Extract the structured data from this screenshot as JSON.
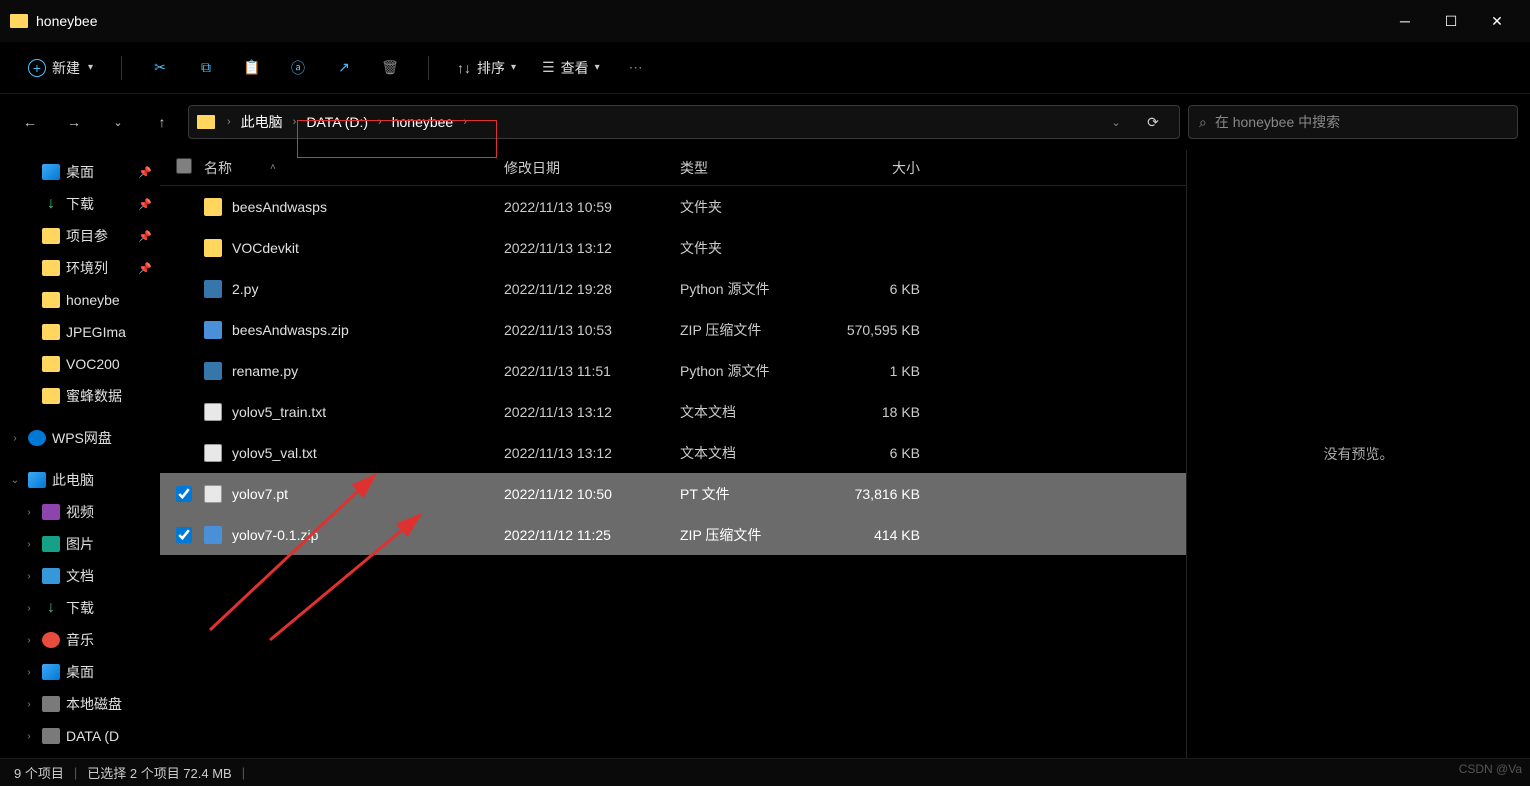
{
  "window": {
    "title": "honeybee"
  },
  "toolbar": {
    "new_label": "新建",
    "sort_label": "排序",
    "view_label": "查看"
  },
  "breadcrumb": {
    "items": [
      "此电脑",
      "DATA (D:)",
      "honeybee"
    ]
  },
  "search": {
    "placeholder": "在 honeybee 中搜索"
  },
  "sidebar": {
    "quick": [
      {
        "label": "桌面",
        "pinned": true,
        "icon": "ico-desktop"
      },
      {
        "label": "下载",
        "pinned": true,
        "icon": "ico-download"
      },
      {
        "label": "项目参",
        "pinned": true,
        "icon": "ico-folder"
      },
      {
        "label": "环境列",
        "pinned": true,
        "icon": "ico-folder"
      },
      {
        "label": "honeybe",
        "pinned": false,
        "icon": "ico-folder"
      },
      {
        "label": "JPEGIma",
        "pinned": false,
        "icon": "ico-folder"
      },
      {
        "label": "VOC200",
        "pinned": false,
        "icon": "ico-folder"
      },
      {
        "label": "蜜蜂数据",
        "pinned": false,
        "icon": "ico-folder"
      }
    ],
    "wps_label": "WPS网盘",
    "this_pc_label": "此电脑",
    "pc_items": [
      {
        "label": "视频",
        "icon": "ico-video"
      },
      {
        "label": "图片",
        "icon": "ico-pic"
      },
      {
        "label": "文档",
        "icon": "ico-doc"
      },
      {
        "label": "下载",
        "icon": "ico-download"
      },
      {
        "label": "音乐",
        "icon": "ico-music"
      },
      {
        "label": "桌面",
        "icon": "ico-desktop"
      },
      {
        "label": "本地磁盘",
        "icon": "ico-disk"
      },
      {
        "label": "DATA (D",
        "icon": "ico-disk"
      }
    ]
  },
  "columns": {
    "name": "名称",
    "date": "修改日期",
    "type": "类型",
    "size": "大小"
  },
  "files": [
    {
      "name": "beesAndwasps",
      "date": "2022/11/13 10:59",
      "type": "文件夹",
      "size": "",
      "icon": "fico-folder",
      "selected": false
    },
    {
      "name": "VOCdevkit",
      "date": "2022/11/13 13:12",
      "type": "文件夹",
      "size": "",
      "icon": "fico-folder",
      "selected": false
    },
    {
      "name": "2.py",
      "date": "2022/11/12 19:28",
      "type": "Python 源文件",
      "size": "6 KB",
      "icon": "fico-py",
      "selected": false
    },
    {
      "name": "beesAndwasps.zip",
      "date": "2022/11/13 10:53",
      "type": "ZIP 压缩文件",
      "size": "570,595 KB",
      "icon": "fico-zip",
      "selected": false
    },
    {
      "name": "rename.py",
      "date": "2022/11/13 11:51",
      "type": "Python 源文件",
      "size": "1 KB",
      "icon": "fico-py",
      "selected": false
    },
    {
      "name": "yolov5_train.txt",
      "date": "2022/11/13 13:12",
      "type": "文本文档",
      "size": "18 KB",
      "icon": "fico-txt",
      "selected": false
    },
    {
      "name": "yolov5_val.txt",
      "date": "2022/11/13 13:12",
      "type": "文本文档",
      "size": "6 KB",
      "icon": "fico-txt",
      "selected": false
    },
    {
      "name": "yolov7.pt",
      "date": "2022/11/12 10:50",
      "type": "PT 文件",
      "size": "73,816 KB",
      "icon": "fico-file",
      "selected": true
    },
    {
      "name": "yolov7-0.1.zip",
      "date": "2022/11/12 11:25",
      "type": "ZIP 压缩文件",
      "size": "414 KB",
      "icon": "fico-zip",
      "selected": true
    }
  ],
  "preview": {
    "empty_text": "没有预览。"
  },
  "status": {
    "items_text": "9 个项目",
    "selected_text": "已选择 2 个项目 72.4 MB"
  },
  "watermark": "CSDN @Va"
}
